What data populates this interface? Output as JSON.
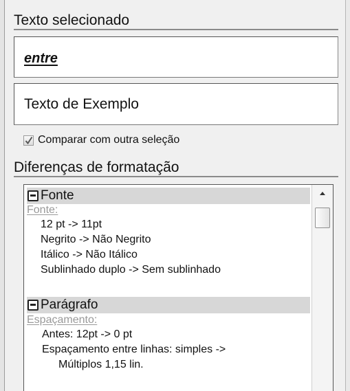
{
  "selected_text_section": {
    "heading": "Texto selecionado",
    "selected_text": "entre",
    "sample_text": "Texto de Exemplo",
    "compare_checkbox": {
      "label": "Comparar com outra seleção",
      "checked": true
    }
  },
  "differences_section": {
    "heading": "Diferenças de formatação",
    "groups": [
      {
        "title": "Fonte",
        "subheading": "Fonte:",
        "items": [
          "12 pt -> 11pt",
          "Negrito -> Não Negrito",
          "Itálico -> Não Itálico",
          "Sublinhado duplo -> Sem sublinhado"
        ]
      },
      {
        "title": "Parágrafo",
        "subheading": "Espaçamento:",
        "items": [
          "Antes:  12pt -> 0 pt",
          "Espaçamento entre linhas: simples ->",
          "Múltiplos 1,15 lin."
        ]
      }
    ]
  },
  "icons": {
    "collapse": "collapse-minus-icon",
    "scroll_up": "scroll-up-arrow-icon",
    "check": "checkmark-icon"
  }
}
